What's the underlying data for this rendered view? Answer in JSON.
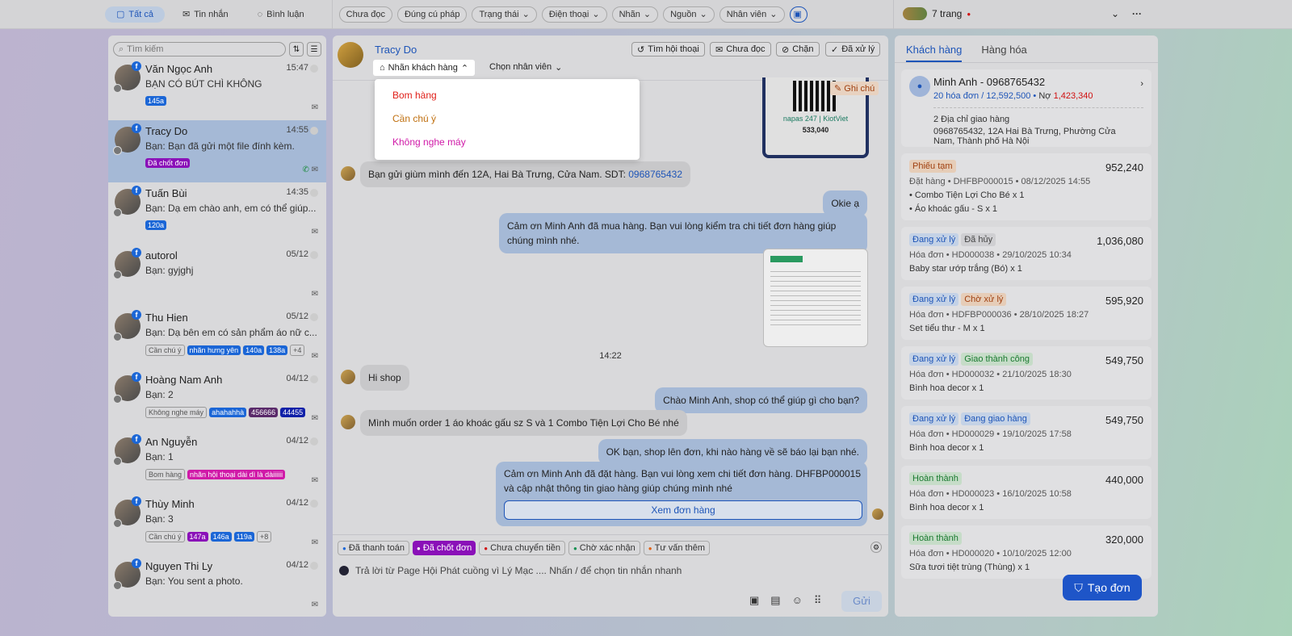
{
  "topbar": {
    "tabs": [
      "Tất cả",
      "Tin nhắn",
      "Bình luận"
    ],
    "filters": [
      "Chưa đọc",
      "Đúng cú pháp",
      "Trạng thái",
      "Điện thoại",
      "Nhãn",
      "Nguồn",
      "Nhân viên"
    ],
    "pages": "7 trang",
    "more": "···"
  },
  "left": {
    "search_placeholder": "Tìm kiếm",
    "conversations": [
      {
        "name": "Văn Ngọc Anh",
        "time": "15:47",
        "msg": "BẠN CÓ BÚT CHÌ KHÔNG",
        "tags": [
          {
            "t": "145a",
            "c": "#1b66d6"
          }
        ]
      },
      {
        "name": "Tracy Do",
        "time": "14:55",
        "msg": "Bạn: Bạn đã gửi một file đính kèm.",
        "tags": [
          {
            "t": "Đã chốt đơn",
            "c": "#8a10b8"
          }
        ]
      },
      {
        "name": "Tuấn Bùi",
        "time": "14:35",
        "msg": "Bạn: Dạ em chào anh, em có thể giúp...",
        "tags": [
          {
            "t": "120a",
            "c": "#1b66d6"
          }
        ]
      },
      {
        "name": "autorol",
        "time": "05/12",
        "msg": "Bạn: gyjghj",
        "tags": []
      },
      {
        "name": "Thu Hien",
        "time": "05/12",
        "msg": "Bạn: Dạ bên em có sản phẩm áo nữ c...",
        "tags": [
          {
            "t": "Cần chú ý",
            "c": ""
          },
          {
            "t": "nhãn hưng yên",
            "c": "#1b66d6"
          },
          {
            "t": "140a",
            "c": "#1b66d6"
          },
          {
            "t": "138a",
            "c": "#1b66d6"
          },
          {
            "t": "+4",
            "c": ""
          }
        ]
      },
      {
        "name": "Hoàng Nam Anh",
        "time": "04/12",
        "msg": "Bạn: 2",
        "tags": [
          {
            "t": "Không nghe máy",
            "c": ""
          },
          {
            "t": "ahahahhà",
            "c": "#1b66d6"
          },
          {
            "t": "456666",
            "c": "#5a2a6a"
          },
          {
            "t": "44455",
            "c": "#1020a8"
          }
        ]
      },
      {
        "name": "An Nguyễn",
        "time": "04/12",
        "msg": "Bạn: 1",
        "tags": [
          {
            "t": "Bom hàng",
            "c": ""
          },
          {
            "t": "nhãn hội thoại dài dì là dàiiiiii",
            "c": "#d01aa8"
          }
        ]
      },
      {
        "name": "Thùy Minh",
        "time": "04/12",
        "msg": "Bạn: 3",
        "tags": [
          {
            "t": "Cần chú ý",
            "c": ""
          },
          {
            "t": "147a",
            "c": "#8a10b8"
          },
          {
            "t": "146a",
            "c": "#1b66d6"
          },
          {
            "t": "119a",
            "c": "#1b66d6"
          },
          {
            "t": "+8",
            "c": ""
          }
        ]
      },
      {
        "name": "Nguyen Thi Ly",
        "time": "04/12",
        "msg": "Bạn: You sent a photo.",
        "tags": []
      }
    ]
  },
  "chat": {
    "name": "Tracy Do",
    "label_btn": "Nhãn khách hàng",
    "staff_btn": "Chọn nhân viên",
    "actions": [
      "Tìm hội thoại",
      "Chưa đọc",
      "Chặn",
      "Đã xử lý"
    ],
    "dropdown": [
      {
        "t": "Bom hàng",
        "c": "#e0201a"
      },
      {
        "t": "Cần chú ý",
        "c": "#c07010"
      },
      {
        "t": "Không nghe máy",
        "c": "#d01aa8"
      }
    ],
    "note_btn": "Ghi chú",
    "qr_amount": "533,040",
    "qr_brand": "napas 247 | KiotViet",
    "msg_in1": "Bạn gửi giùm mình đến 12A, Hai Bà Trưng, Cửa Nam. SDT: ",
    "msg_in1_phone": "0968765432",
    "msg_out1": "Okie ạ",
    "msg_out2": "Cảm ơn Minh Anh đã mua hàng. Bạn vui lòng kiểm tra chi tiết đơn hàng giúp chúng mình nhé.",
    "time_sep": "14:22",
    "msg_in2": "Hi shop",
    "msg_out3": "Chào Minh Anh, shop có thể giúp gì cho bạn?",
    "msg_in3": "Mình muốn order 1 áo khoác gấu sz S và 1 Combo Tiện Lợi Cho Bé nhé",
    "msg_out4": "OK bạn, shop lên đơn, khi nào hàng về sẽ báo lại bạn nhé.",
    "msg_out5": "Cảm ơn Minh Anh đã đặt hàng. Bạn vui lòng xem chi tiết đơn hàng. DHFBP000015 và cập nhật thông tin giao hàng giúp chúng mình nhé",
    "view_order": "Xem đơn hàng",
    "quick_tags": [
      {
        "t": "Đã thanh toán",
        "c": "#1b66d6"
      },
      {
        "t": "Đã chốt đơn",
        "c": "#ffffff"
      },
      {
        "t": "Chưa chuyển tiền",
        "c": "#d01010"
      },
      {
        "t": "Chờ xác nhận",
        "c": "#109050"
      },
      {
        "t": "Tư vấn thêm",
        "c": "#e06010"
      }
    ],
    "reply_placeholder": "Trả lời từ Page Hội Phát cuồng vì Lý Mạc .... Nhấn / để chọn tin nhắn nhanh",
    "send": "Gửi"
  },
  "right": {
    "tabs": [
      "Khách hàng",
      "Hàng hóa"
    ],
    "customer": {
      "name": "Minh Anh - 0968765432",
      "orders": "20 hóa đơn / 12,592,500",
      "debt_label": "Nợ",
      "debt": "1,423,340",
      "addr_count": "2 Địa chỉ giao hàng",
      "address": "0968765432, 12A Hai Bà Trưng, Phường Cửa Nam, Thành phố Hà Nội"
    },
    "orders": [
      {
        "status": [
          {
            "t": "Phiếu tạm",
            "bg": "#e6cdb8",
            "fg": "#a04010"
          }
        ],
        "amount": "952,240",
        "meta": "Đặt hàng • DHFBP000015 • 08/12/2025 14:55",
        "items": [
          "• Combo Tiện Lợi Cho Bé x 1",
          "• Áo khoác gấu - S x 1"
        ]
      },
      {
        "status": [
          {
            "t": "Đang xử lý",
            "bg": "#c4d2e6",
            "fg": "#1e55b8"
          },
          {
            "t": "Đã hủy",
            "bg": "#cfcfd2",
            "fg": "#444"
          }
        ],
        "amount": "1,036,080",
        "meta": "Hóa đơn • HD000038 • 29/10/2025 10:34",
        "items": [
          "Baby star ướp trắng (Bó) x 1"
        ]
      },
      {
        "status": [
          {
            "t": "Đang xử lý",
            "bg": "#c4d2e6",
            "fg": "#1e55b8"
          },
          {
            "t": "Chờ xử lý",
            "bg": "#e6cdb8",
            "fg": "#a04010"
          }
        ],
        "amount": "595,920",
        "meta": "Hóa đơn • HDFBP000036 • 28/10/2025 18:27",
        "items": [
          "Set tiểu thư - M x 1"
        ]
      },
      {
        "status": [
          {
            "t": "Đang xử lý",
            "bg": "#c4d2e6",
            "fg": "#1e55b8"
          },
          {
            "t": "Giao thành công",
            "bg": "#c6dcc8",
            "fg": "#1a7a30"
          }
        ],
        "amount": "549,750",
        "meta": "Hóa đơn • HD000032 • 21/10/2025 18:30",
        "items": [
          "Bình hoa decor x 1"
        ]
      },
      {
        "status": [
          {
            "t": "Đang xử lý",
            "bg": "#c4d2e6",
            "fg": "#1e55b8"
          },
          {
            "t": "Đang giao hàng",
            "bg": "#c4d2e6",
            "fg": "#1e55b8"
          }
        ],
        "amount": "549,750",
        "meta": "Hóa đơn • HD000029 • 19/10/2025 17:58",
        "items": [
          "Bình hoa decor x 1"
        ]
      },
      {
        "status": [
          {
            "t": "Hoàn thành",
            "bg": "#c6dcc8",
            "fg": "#1a7a30"
          }
        ],
        "amount": "440,000",
        "meta": "Hóa đơn • HD000023 • 16/10/2025 10:58",
        "items": [
          "Bình hoa decor x 1"
        ]
      },
      {
        "status": [
          {
            "t": "Hoàn thành",
            "bg": "#c6dcc8",
            "fg": "#1a7a30"
          }
        ],
        "amount": "320,000",
        "meta": "Hóa đơn • HD000020 • 10/10/2025 12:00",
        "items": [
          "Sữa tươi tiệt trùng (Thùng) x 1"
        ]
      }
    ],
    "create_order": "Tạo đơn"
  }
}
